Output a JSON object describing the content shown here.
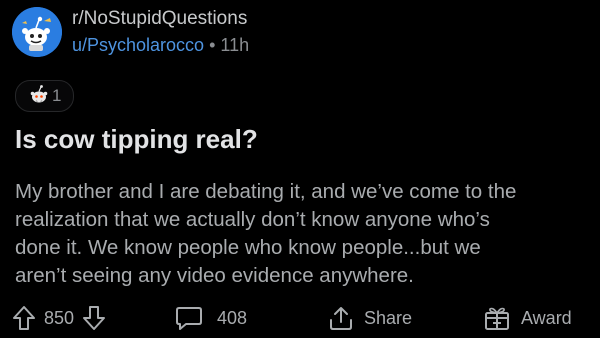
{
  "post": {
    "subreddit": "r/NoStupidQuestions",
    "author": "u/Psycholarocco",
    "separator": "•",
    "age": "11h",
    "award_count": "1",
    "title": "Is cow tipping real?",
    "body_lines": [
      "My brother and I are debating it, and we’ve come to the",
      "realization that we actually don’t know anyone who’s",
      "done it.  We know people who know people...but we",
      "aren’t seeing any video evidence anywhere."
    ]
  },
  "actions": {
    "score": "850",
    "comments": "408",
    "share_label": "Share",
    "award_label": "Award"
  },
  "icons": {
    "avatar": "subreddit-avatar-icon",
    "award": "award-badge-icon",
    "upvote": "upvote-arrow-icon",
    "downvote": "downvote-arrow-icon",
    "comment": "comment-bubble-icon",
    "share": "share-icon",
    "gift": "gift-icon"
  },
  "colors": {
    "background": "#000000",
    "username": "#4e94e0",
    "avatar_bg": "#2a7de1"
  }
}
